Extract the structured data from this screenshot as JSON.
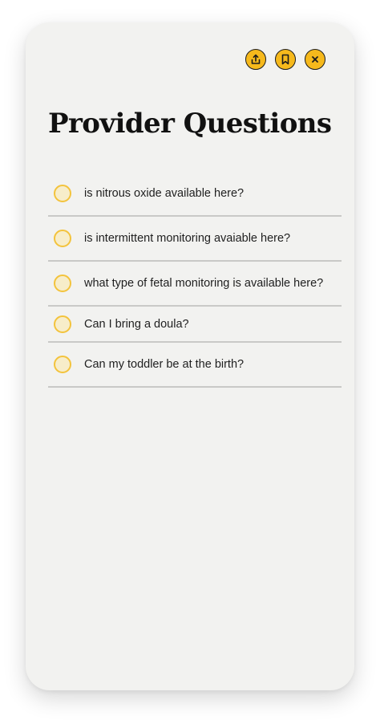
{
  "header": {
    "title": "Provider Questions",
    "actions": [
      {
        "icon": "share-icon"
      },
      {
        "icon": "bookmark-icon"
      },
      {
        "icon": "close-icon"
      }
    ]
  },
  "questions": [
    {
      "text": "is nitrous oxide available here?",
      "checked": false
    },
    {
      "text": "is intermittent monitoring avaiable here?",
      "checked": false
    },
    {
      "text": "what type of fetal monitoring is available here?",
      "checked": false
    },
    {
      "text": "Can I bring a doula?",
      "checked": false
    },
    {
      "text": "Can my toddler be at the birth?",
      "checked": false
    }
  ],
  "colors": {
    "accent": "#f6b91c",
    "checkbox_border": "#f3c33c",
    "checkbox_fill": "#f7edca",
    "card_background": "#f2f2f0",
    "divider": "#c9c9c7"
  }
}
